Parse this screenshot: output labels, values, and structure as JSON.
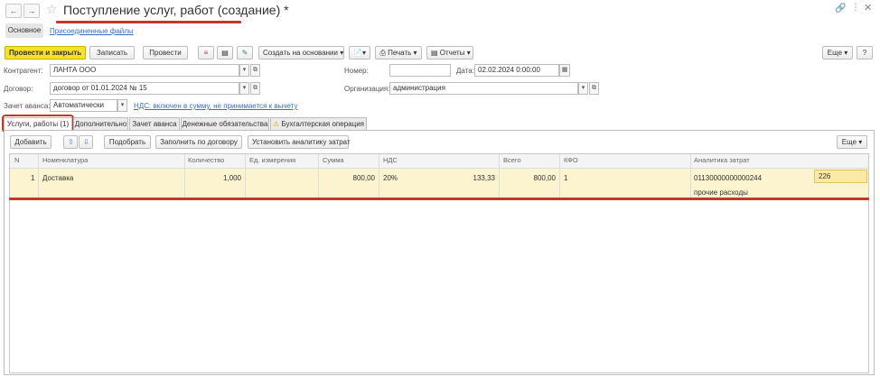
{
  "window": {
    "title": "Поступление услуг, работ (создание) *"
  },
  "top_tabs": [
    {
      "label": "Основное"
    },
    {
      "label": "Присоединенные файлы"
    }
  ],
  "toolbar": {
    "post_and_close": "Провести и закрыть",
    "save": "Записать",
    "post": "Провести",
    "create_based_on": "Создать на основании",
    "print": "Печать",
    "reports": "Отчеты",
    "more": "Еще"
  },
  "form": {
    "counterparty_label": "Контрагент:",
    "counterparty_value": "ЛАНТА ООО",
    "number_label": "Номер:",
    "number_value": "",
    "date_label": "Дата:",
    "date_value": "02.02.2024  0:00:00",
    "contract_label": "Договор:",
    "contract_value": "договор от 01.01.2024 № 15",
    "organization_label": "Организация:",
    "organization_value": "администрация",
    "advance_label": "Зачет аванса:",
    "advance_value": "Автоматически",
    "vat_link": "НДС: включен в сумму, не принимается к вычету"
  },
  "doc_tabs": [
    {
      "label": "Услуги, работы (1)"
    },
    {
      "label": "Дополнительно"
    },
    {
      "label": "Зачет аванса"
    },
    {
      "label": "Денежные обязательства"
    },
    {
      "label": "Бухгалтерская операция"
    }
  ],
  "grid_toolbar": {
    "add": "Добавить",
    "pick": "Подобрать",
    "fill_by_contract": "Заполнить по договору",
    "set_analytics": "Установить аналитику затрат",
    "more": "Еще"
  },
  "table": {
    "columns": [
      "N",
      "Номенклатура",
      "Количество",
      "Ед. измерения",
      "Сумма",
      "НДС",
      "Всего",
      "КФО",
      "Аналитика затрат"
    ],
    "rows": [
      {
        "n": "1",
        "item": "Доставка",
        "qty": "1,000",
        "unit": "",
        "sum": "800,00",
        "vat_rate": "20%",
        "vat_sum": "133,33",
        "total": "800,00",
        "kfo": "1",
        "analytics_code": "01130000000000244",
        "analytics_value": "226",
        "analytics_note": "прочие расходы"
      }
    ]
  },
  "colors": {
    "accent_yellow": "#f8e227",
    "row_highlight": "#fcf3cf",
    "annotation_red": "#c0392b",
    "link_blue": "#3a6cc4"
  }
}
